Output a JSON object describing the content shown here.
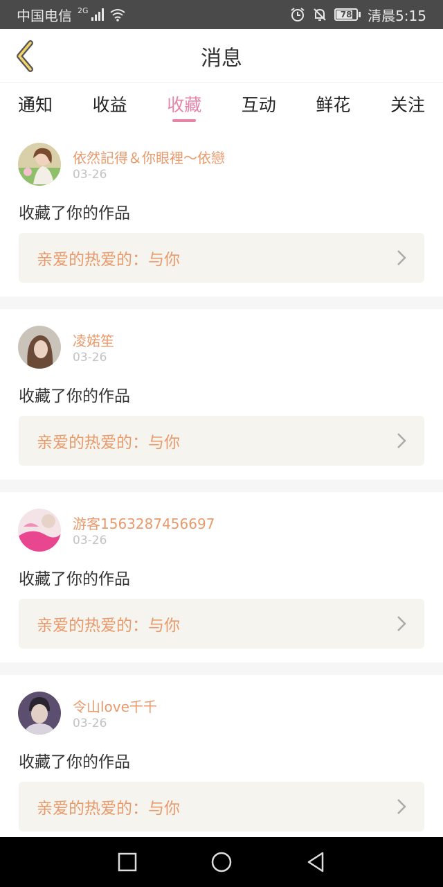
{
  "status_bar": {
    "carrier": "中国电信",
    "network": "2G",
    "time": "清晨5:15",
    "battery": "78"
  },
  "header": {
    "title": "消息",
    "back_icon": "chevron-left-icon"
  },
  "tabs": [
    {
      "label": "通知",
      "active": false
    },
    {
      "label": "收益",
      "active": false
    },
    {
      "label": "收藏",
      "active": true
    },
    {
      "label": "互动",
      "active": false
    },
    {
      "label": "鲜花",
      "active": false
    },
    {
      "label": "关注",
      "active": false
    }
  ],
  "colors": {
    "accent": "#e784a7",
    "name": "#e89a6c",
    "box_bg": "#f5f4ee"
  },
  "feed": [
    {
      "user": "依然記得＆你眼裡～依戀",
      "date": "03-26",
      "action": "收藏了你的作品",
      "work": "亲爱的热爱的：与你"
    },
    {
      "user": "凌婼笙",
      "date": "03-26",
      "action": "收藏了你的作品",
      "work": "亲爱的热爱的：与你"
    },
    {
      "user": "游客1563287456697",
      "date": "03-26",
      "action": "收藏了你的作品",
      "work": "亲爱的热爱的：与你"
    },
    {
      "user": "令山love千千",
      "date": "03-26",
      "action": "收藏了你的作品",
      "work": "亲爱的热爱的：与你"
    }
  ],
  "nav": {
    "recent": "square-icon",
    "home": "circle-icon",
    "back": "triangle-back-icon"
  }
}
